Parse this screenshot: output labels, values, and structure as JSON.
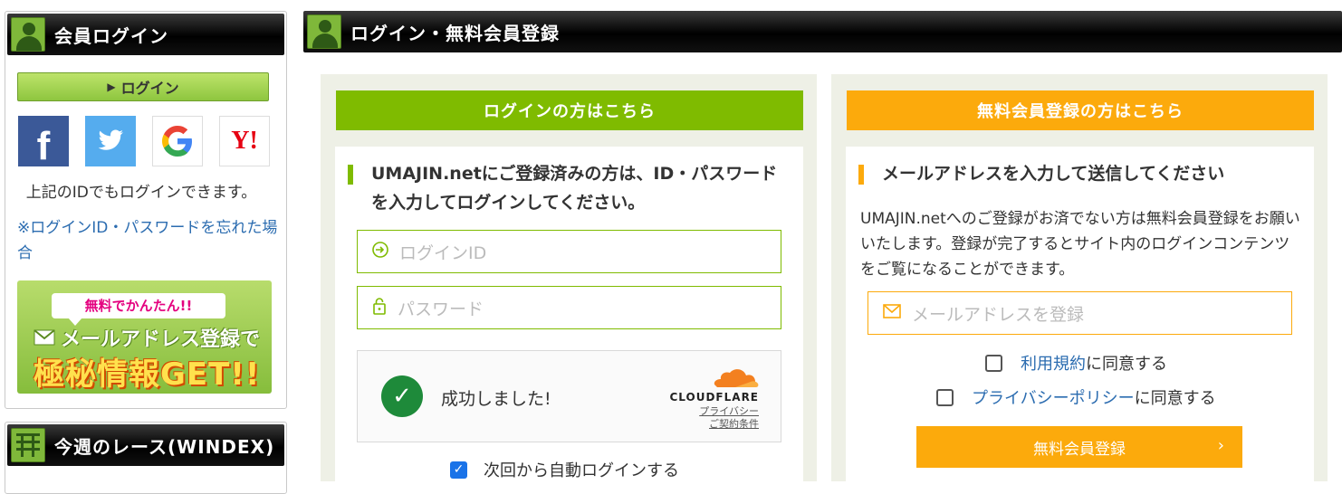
{
  "sidebar": {
    "member_login": {
      "title": "会員ログイン",
      "login_button": "ログイン",
      "social": [
        {
          "name": "facebook",
          "glyph": "f"
        },
        {
          "name": "twitter",
          "glyph": "t"
        },
        {
          "name": "google",
          "glyph": "G"
        },
        {
          "name": "yahoo",
          "glyph": "Y!"
        }
      ],
      "note": "上記のIDでもログインできます。",
      "forgot_link": "※ログインID・パスワードを忘れた場合",
      "banner": {
        "bubble": "無料でかんたん!!",
        "line1": "メールアドレス登録で",
        "line2": "極秘情報GET!!"
      }
    },
    "weekly_race": {
      "title": "今週のレース(WINDEX)"
    }
  },
  "main": {
    "title": "ログイン・無料会員登録",
    "login": {
      "header": "ログインの方はこちら",
      "section_title_line1": "UMAJIN.netにご登録済みの方は、ID・パスワード",
      "section_title_line2": "を入力してログインしてください。",
      "login_id_placeholder": "ログインID",
      "password_placeholder": "パスワード",
      "captcha": {
        "status": "成功しました!",
        "brand": "CLOUDFLARE",
        "privacy": "プライバシー",
        "terms": "ご契約条件"
      },
      "remember": {
        "label": "次回から自動ログインする",
        "checked": true
      }
    },
    "register": {
      "header": "無料会員登録の方はこちら",
      "section_title": "メールアドレスを入力して送信してください",
      "description": "UMAJIN.netへのご登録がお済でない方は無料会員登録をお願いいたします。登録が完了するとサイト内のログインコンテンツをご覧になることができます。",
      "email_placeholder": "メールアドレスを登録",
      "terms_link": "利用規約",
      "terms_suffix": "に同意する",
      "privacy_link": "プライバシーポリシー",
      "privacy_suffix": "に同意する",
      "submit": "無料会員登録"
    }
  },
  "colors": {
    "green": "#7fbb00",
    "orange": "#fcaa0c",
    "link": "#2b6cb0",
    "panel_bg": "#eef0e6"
  }
}
